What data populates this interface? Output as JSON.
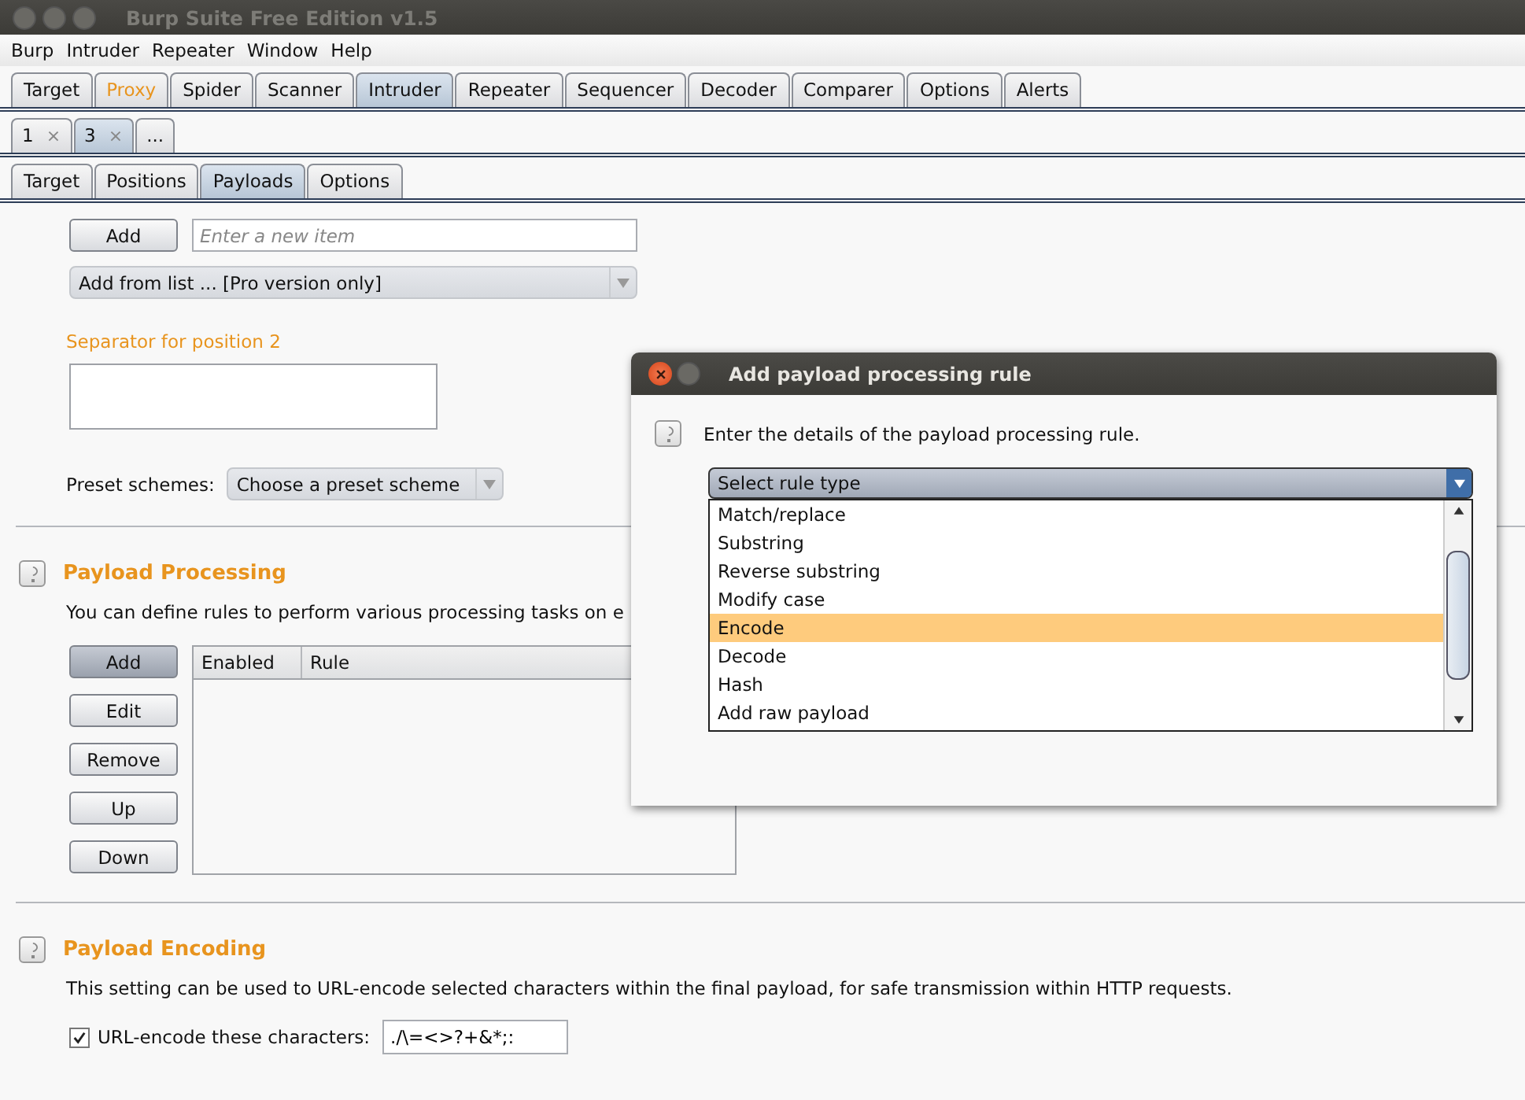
{
  "window": {
    "title": "Burp Suite Free Edition v1.5"
  },
  "menu": [
    "Burp",
    "Intruder",
    "Repeater",
    "Window",
    "Help"
  ],
  "main_tabs": [
    {
      "label": "Target",
      "selected": false,
      "alert": false
    },
    {
      "label": "Proxy",
      "selected": false,
      "alert": true
    },
    {
      "label": "Spider",
      "selected": false,
      "alert": false
    },
    {
      "label": "Scanner",
      "selected": false,
      "alert": false
    },
    {
      "label": "Intruder",
      "selected": true,
      "alert": false
    },
    {
      "label": "Repeater",
      "selected": false,
      "alert": false
    },
    {
      "label": "Sequencer",
      "selected": false,
      "alert": false
    },
    {
      "label": "Decoder",
      "selected": false,
      "alert": false
    },
    {
      "label": "Comparer",
      "selected": false,
      "alert": false
    },
    {
      "label": "Options",
      "selected": false,
      "alert": false
    },
    {
      "label": "Alerts",
      "selected": false,
      "alert": false
    }
  ],
  "attack_tabs": [
    {
      "label": "1",
      "selected": false,
      "close": "×"
    },
    {
      "label": "3",
      "selected": true,
      "close": "×"
    },
    {
      "label": "...",
      "selected": false
    }
  ],
  "section_tabs": [
    {
      "label": "Target",
      "selected": false
    },
    {
      "label": "Positions",
      "selected": false
    },
    {
      "label": "Payloads",
      "selected": true
    },
    {
      "label": "Options",
      "selected": false
    }
  ],
  "add_item": {
    "button": "Add",
    "placeholder": "Enter a new item"
  },
  "add_from_list": {
    "value": "Add from list ... [Pro version only]"
  },
  "separator": {
    "label": "Separator for position 2"
  },
  "preset": {
    "label": "Preset schemes:",
    "value": "Choose a preset scheme"
  },
  "processing": {
    "title": "Payload Processing",
    "description": "You can define rules to perform various processing tasks on e",
    "buttons": [
      {
        "label": "Add",
        "pressed": true
      },
      {
        "label": "Edit",
        "pressed": false
      },
      {
        "label": "Remove",
        "pressed": false
      },
      {
        "label": "Up",
        "pressed": false
      },
      {
        "label": "Down",
        "pressed": false
      }
    ],
    "columns": [
      "Enabled",
      "Rule"
    ]
  },
  "encoding": {
    "title": "Payload Encoding",
    "description": "This setting can be used to URL-encode selected characters within the final payload, for safe transmission within HTTP requests.",
    "checkbox": {
      "label": "URL-encode these characters:",
      "checked": true
    },
    "value": "./\\=<>?+&*;:"
  },
  "dialog": {
    "title": "Add payload processing rule",
    "instruction": "Enter the details of the payload processing rule.",
    "select": {
      "value": "Select rule type"
    },
    "options": [
      {
        "label": "Match/replace",
        "selected": false
      },
      {
        "label": "Substring",
        "selected": false
      },
      {
        "label": "Reverse substring",
        "selected": false
      },
      {
        "label": "Modify case",
        "selected": false
      },
      {
        "label": "Encode",
        "selected": true
      },
      {
        "label": "Decode",
        "selected": false
      },
      {
        "label": "Hash",
        "selected": false
      },
      {
        "label": "Add raw payload",
        "selected": false
      }
    ]
  }
}
